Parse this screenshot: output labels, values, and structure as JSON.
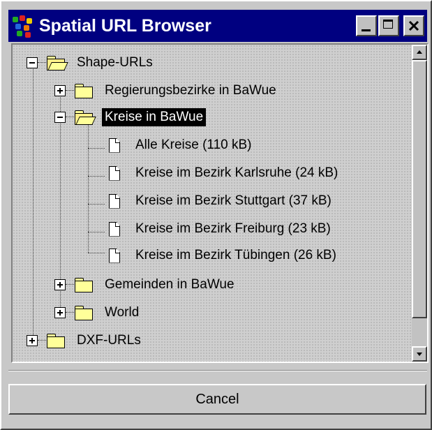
{
  "window": {
    "title": "Spatial URL Browser",
    "title_bar_color": "#000080"
  },
  "title_buttons": {
    "minimize_icon": "minimize-icon",
    "maximize_icon": "maximize-icon",
    "close_icon": "close-icon"
  },
  "tree": {
    "shape_urls": "Shape-URLs",
    "regierungsbezirke": "Regierungsbezirke in BaWue",
    "kreise": "Kreise in BaWue",
    "kreise_files": [
      "Alle Kreise (110 kB)",
      "Kreise im Bezirk Karlsruhe (24 kB)",
      "Kreise im Bezirk Stuttgart (37 kB)",
      "Kreise im Bezirk Freiburg (23 kB)",
      "Kreise im Bezirk Tübingen (26 kB)"
    ],
    "gemeinden": "Gemeinden in BaWue",
    "world": "World",
    "dxf_urls": "DXF-URLs"
  },
  "footer": {
    "cancel_label": "Cancel"
  }
}
